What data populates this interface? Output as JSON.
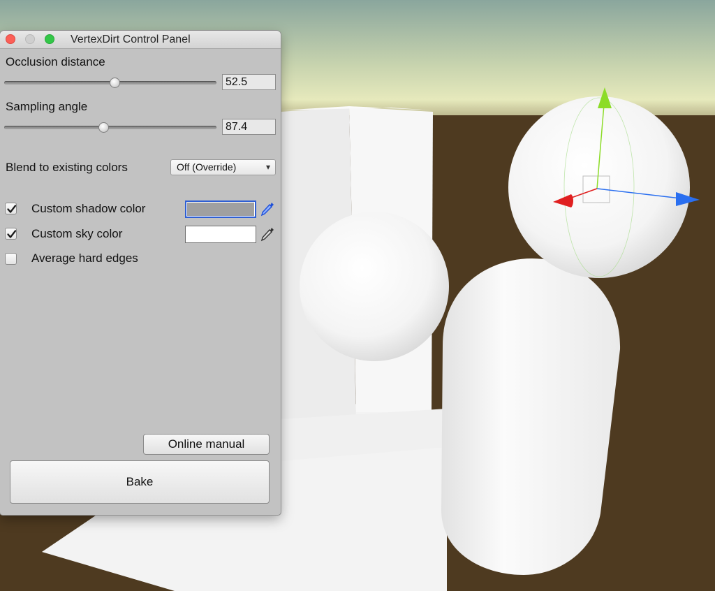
{
  "window": {
    "title": "VertexDirt Control Panel"
  },
  "occlusion": {
    "label": "Occlusion distance",
    "value": "52.5",
    "slider_fraction": 0.52
  },
  "sampling": {
    "label": "Sampling angle",
    "value": "87.4",
    "slider_fraction": 0.47
  },
  "blend": {
    "label": "Blend to existing colors",
    "selected": "Off (Override)",
    "arrow_icon": "updown-arrows-icon"
  },
  "checkboxes": {
    "shadow": {
      "label": "Custom shadow color",
      "checked": true,
      "color": "#a0a0a0"
    },
    "sky": {
      "label": "Custom sky color",
      "checked": true,
      "color": "#ffffff"
    },
    "hard_edges": {
      "label": "Average hard edges",
      "checked": false
    }
  },
  "buttons": {
    "manual": "Online manual",
    "bake": "Bake"
  },
  "icons": {
    "picker": "eyedropper-icon",
    "close": "close-window-icon",
    "minimize": "minimize-window-icon",
    "maximize": "maximize-window-icon"
  },
  "colors": {
    "scene_ground": "#4e3a20",
    "scene_sky_top": "#8ea89d",
    "scene_horizon": "#e2e6b8",
    "accent_blue": "#2f5fd3",
    "gizmo_x": "#e02020",
    "gizmo_y": "#8cdc28",
    "gizmo_z": "#2a6ff0"
  }
}
